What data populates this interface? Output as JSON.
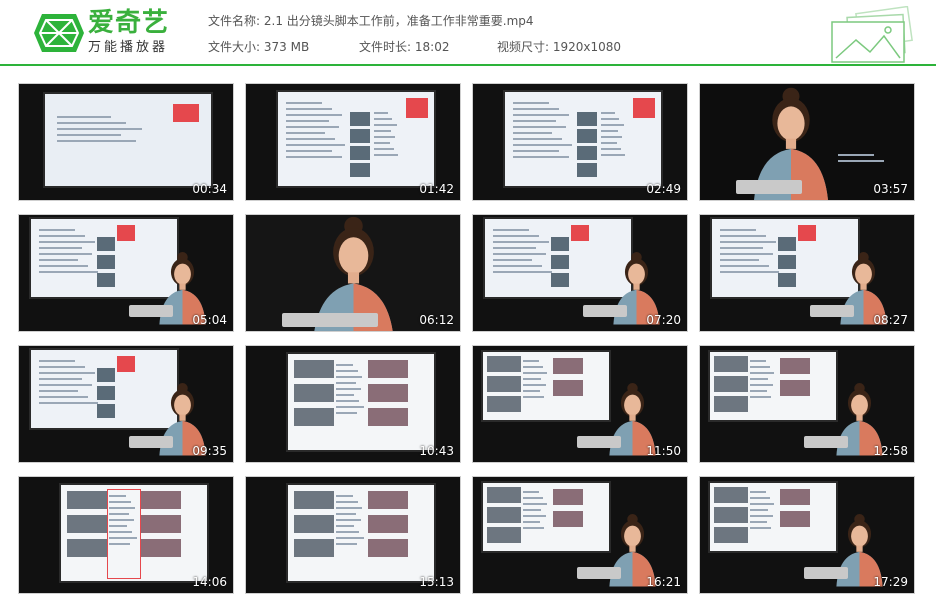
{
  "header": {
    "brand_title": "爱奇艺",
    "brand_subtitle": "万能播放器",
    "file_name_label": "文件名称:",
    "file_name": "2.1 出分镜头脚本工作前，准备工作非常重要.mp4",
    "file_size_label": "文件大小:",
    "file_size": "373 MB",
    "duration_label": "文件时长:",
    "duration": "18:02",
    "resolution_label": "视频尺寸:",
    "resolution": "1920x1080",
    "accent_color": "#2db33a"
  },
  "thumbnails": [
    {
      "time": "00:34",
      "scene": "slide-red-small"
    },
    {
      "time": "01:42",
      "scene": "slide-table"
    },
    {
      "time": "02:49",
      "scene": "slide-table"
    },
    {
      "time": "03:57",
      "scene": "presenter-text"
    },
    {
      "time": "05:04",
      "scene": "slide-person"
    },
    {
      "time": "06:12",
      "scene": "presenter-close"
    },
    {
      "time": "07:20",
      "scene": "slide-person"
    },
    {
      "time": "08:27",
      "scene": "slide-person"
    },
    {
      "time": "09:35",
      "scene": "slide-person"
    },
    {
      "time": "10:43",
      "scene": "storyboard"
    },
    {
      "time": "11:50",
      "scene": "storyboard-person"
    },
    {
      "time": "12:58",
      "scene": "storyboard-person"
    },
    {
      "time": "14:06",
      "scene": "storyboard-highlight"
    },
    {
      "time": "15:13",
      "scene": "storyboard"
    },
    {
      "time": "16:21",
      "scene": "storyboard-person"
    },
    {
      "time": "17:29",
      "scene": "storyboard-person"
    }
  ]
}
